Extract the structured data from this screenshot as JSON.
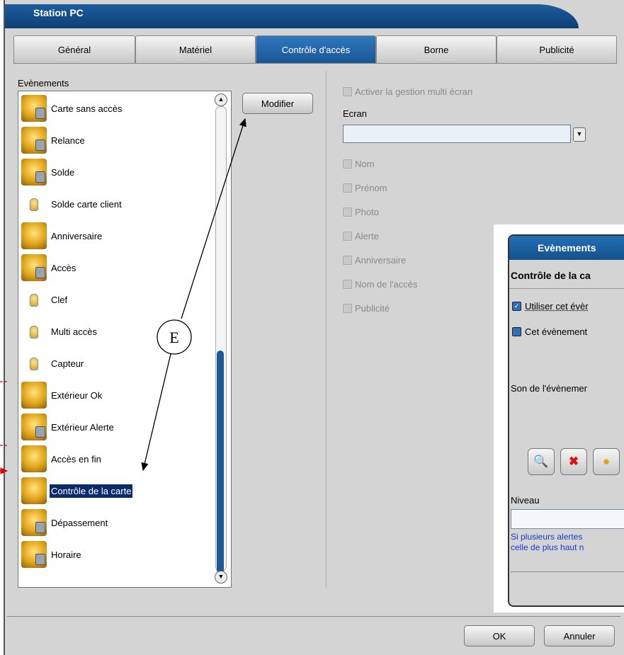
{
  "window": {
    "title": "Station PC"
  },
  "tabs": [
    {
      "label": "Général"
    },
    {
      "label": "Matériel"
    },
    {
      "label": "Contrôle d'accès"
    },
    {
      "label": "Borne"
    },
    {
      "label": "Publicité"
    }
  ],
  "events_panel": {
    "label": "Evènements",
    "modify_button": "Modifier",
    "items": [
      {
        "label": "Carte sans accès",
        "icon": "lock-bulb-icon"
      },
      {
        "label": "Relance",
        "icon": "lock-bulb-icon"
      },
      {
        "label": "Solde",
        "icon": "lock-bulb-icon"
      },
      {
        "label": "Solde carte client",
        "icon": "small-bulb-icon"
      },
      {
        "label": "Anniversaire",
        "icon": "bulb-icon"
      },
      {
        "label": "Accès",
        "icon": "lock-bulb-icon"
      },
      {
        "label": "Clef",
        "icon": "small-bulb-icon"
      },
      {
        "label": "Multi accès",
        "icon": "small-bulb-icon"
      },
      {
        "label": "Capteur",
        "icon": "small-bulb-icon"
      },
      {
        "label": "Extérieur Ok",
        "icon": "bulb-icon"
      },
      {
        "label": "Extérieur Alerte",
        "icon": "lock-bulb-icon"
      },
      {
        "label": "Accès en fin",
        "icon": "bulb-icon"
      },
      {
        "label": "Contrôle de la carte",
        "icon": "bulb-icon",
        "selected": true
      },
      {
        "label": "Dépassement",
        "icon": "lock-bulb-icon"
      },
      {
        "label": "Horaire",
        "icon": "lock-bulb-icon"
      }
    ]
  },
  "screen_panel": {
    "multi_screen_label": "Activer la gestion multi écran",
    "screen_label": "Ecran",
    "screen_value": "",
    "checkboxes": [
      {
        "label": "Nom"
      },
      {
        "label": "Prénom"
      },
      {
        "label": "Photo"
      },
      {
        "label": "Alerte"
      },
      {
        "label": "Anniversaire"
      },
      {
        "label": "Nom de l'accès"
      },
      {
        "label": "Publicité"
      }
    ]
  },
  "annotation": {
    "label": "E"
  },
  "footer": {
    "ok_label": "OK",
    "cancel_label": "Annuler"
  },
  "popup": {
    "title": "Evènements",
    "subtitle": "Contrôle de la ca",
    "use_event": "Utiliser cet évèr",
    "event_flag": "Cet évènement",
    "sound_label": "Son de l'évènemer",
    "level_label": "Niveau",
    "note_line1": "Si plusieurs alertes",
    "note_line2": "celle de plus haut n"
  },
  "colors": {
    "accent": "#1b5595",
    "selected": "#0c2b6c",
    "note": "#1a3bd0"
  }
}
